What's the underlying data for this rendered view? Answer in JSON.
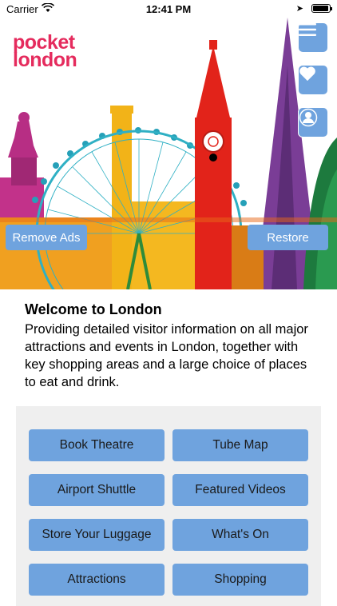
{
  "status": {
    "carrier": "Carrier",
    "time": "12:41 PM"
  },
  "logo": {
    "line1": "pocket",
    "line2": "london"
  },
  "hero": {
    "remove_ads": "Remove Ads",
    "restore": "Restore"
  },
  "welcome": {
    "title": "Welcome to London",
    "body": "Providing detailed visitor information on all major attractions and events in London, together with key shopping areas and a large choice of places to eat and drink."
  },
  "menu": {
    "items": [
      {
        "label": "Book Theatre"
      },
      {
        "label": "Tube Map"
      },
      {
        "label": "Airport Shuttle"
      },
      {
        "label": "Featured Videos"
      },
      {
        "label": "Store Your Luggage"
      },
      {
        "label": "What's On"
      },
      {
        "label": "Attractions"
      },
      {
        "label": "Shopping"
      }
    ]
  },
  "colors": {
    "accent": "#6fa3de",
    "brand": "#e52b5d",
    "panel": "#efefef"
  },
  "icons": [
    "wifi-icon",
    "location-arrow-icon",
    "battery-icon",
    "hamburger-menu-icon",
    "heart-icon",
    "profile-icon"
  ]
}
